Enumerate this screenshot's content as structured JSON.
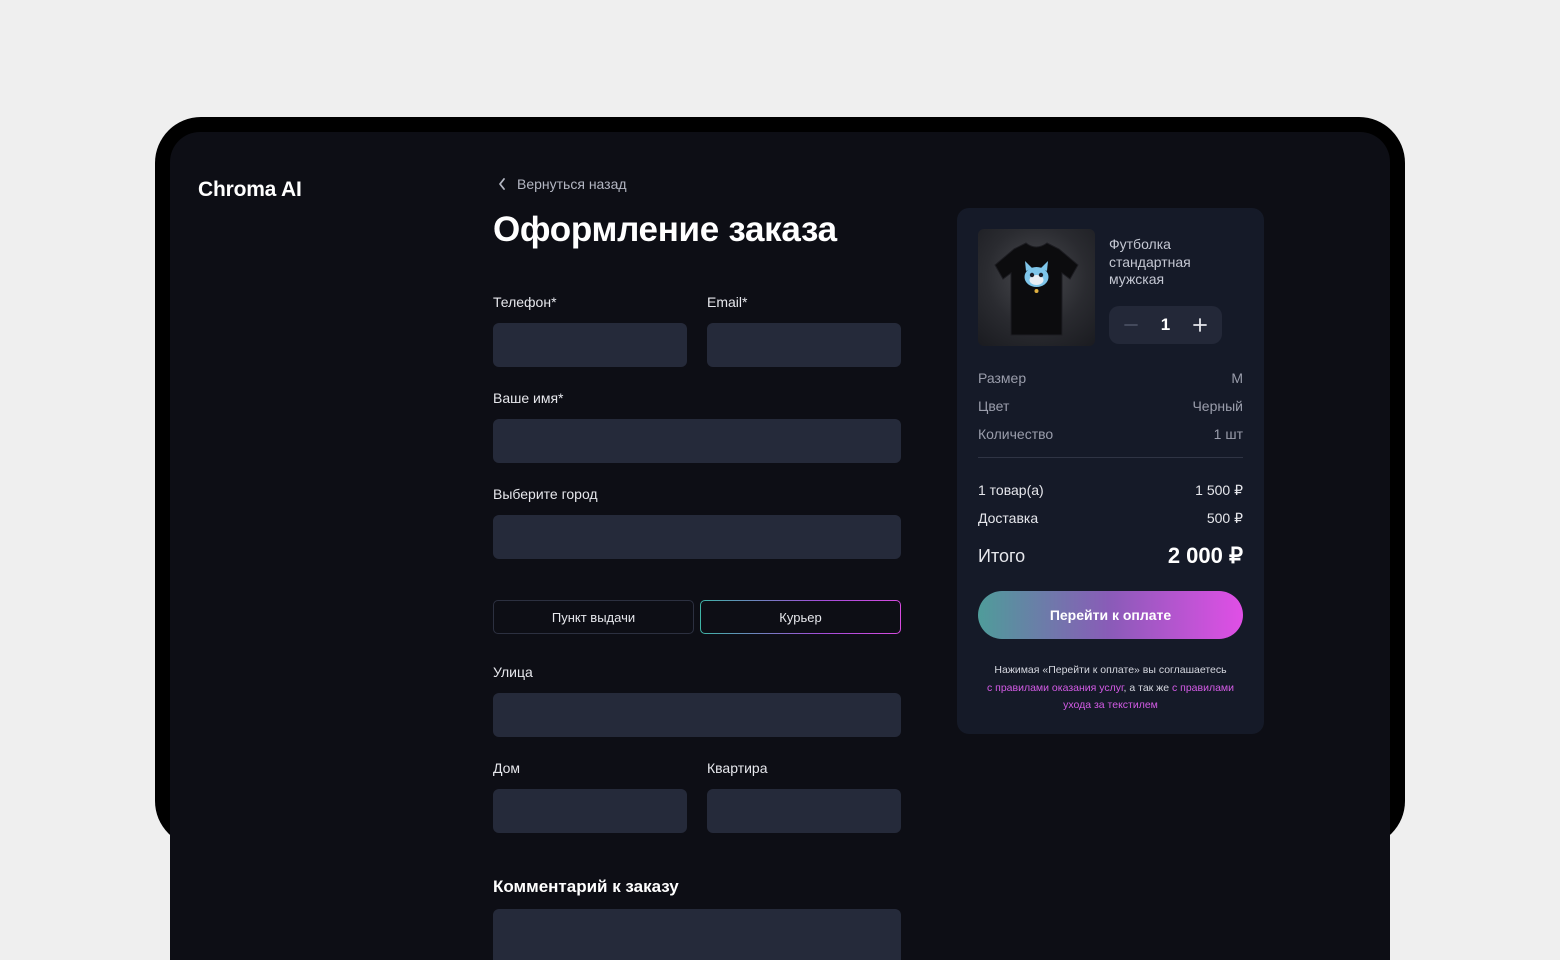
{
  "app": {
    "logo": "Chroma AI"
  },
  "nav": {
    "back_label": "Вернуться назад"
  },
  "page": {
    "title": "Оформление заказа"
  },
  "form": {
    "phone_label": "Телефон*",
    "email_label": "Email*",
    "name_label": "Ваше имя*",
    "city_label": "Выберите город",
    "delivery_options": [
      "Пункт выдачи",
      "Курьер"
    ],
    "delivery_selected": "Курьер",
    "street_label": "Улица",
    "house_label": "Дом",
    "apartment_label": "Квартира",
    "comment_label": "Комментарий к заказу",
    "values": {
      "phone": "",
      "email": "",
      "name": "",
      "city": "",
      "street": "",
      "house": "",
      "apartment": "",
      "comment": ""
    }
  },
  "summary": {
    "product_name": "Футболка стандартная мужская",
    "quantity": "1",
    "details": [
      {
        "key": "Размер",
        "value": "M"
      },
      {
        "key": "Цвет",
        "value": "Черный"
      },
      {
        "key": "Количество",
        "value": "1 шт"
      }
    ],
    "costs": [
      {
        "key": "1 товар(а)",
        "value": "1 500 ₽"
      },
      {
        "key": "Доставка",
        "value": "500 ₽"
      }
    ],
    "total_label": "Итого",
    "total_value": "2 000 ₽",
    "pay_button": "Перейти к оплате",
    "terms": {
      "prefix": "Нажимая «Перейти к оплате» вы соглашаетесь",
      "link1": "с правилами оказания услуг",
      "middle": ", а так же",
      "link2": "с правилами ухода за текстилем"
    }
  },
  "colors": {
    "background": "#efefef",
    "screen": "#0d0e15",
    "field": "#252a3a",
    "card": "#151a28",
    "accent_start": "#4f9c9a",
    "accent_end": "#e04fe6",
    "link": "#d45be6"
  },
  "icons": [
    "chevron-left-icon",
    "minus-icon",
    "plus-icon"
  ]
}
